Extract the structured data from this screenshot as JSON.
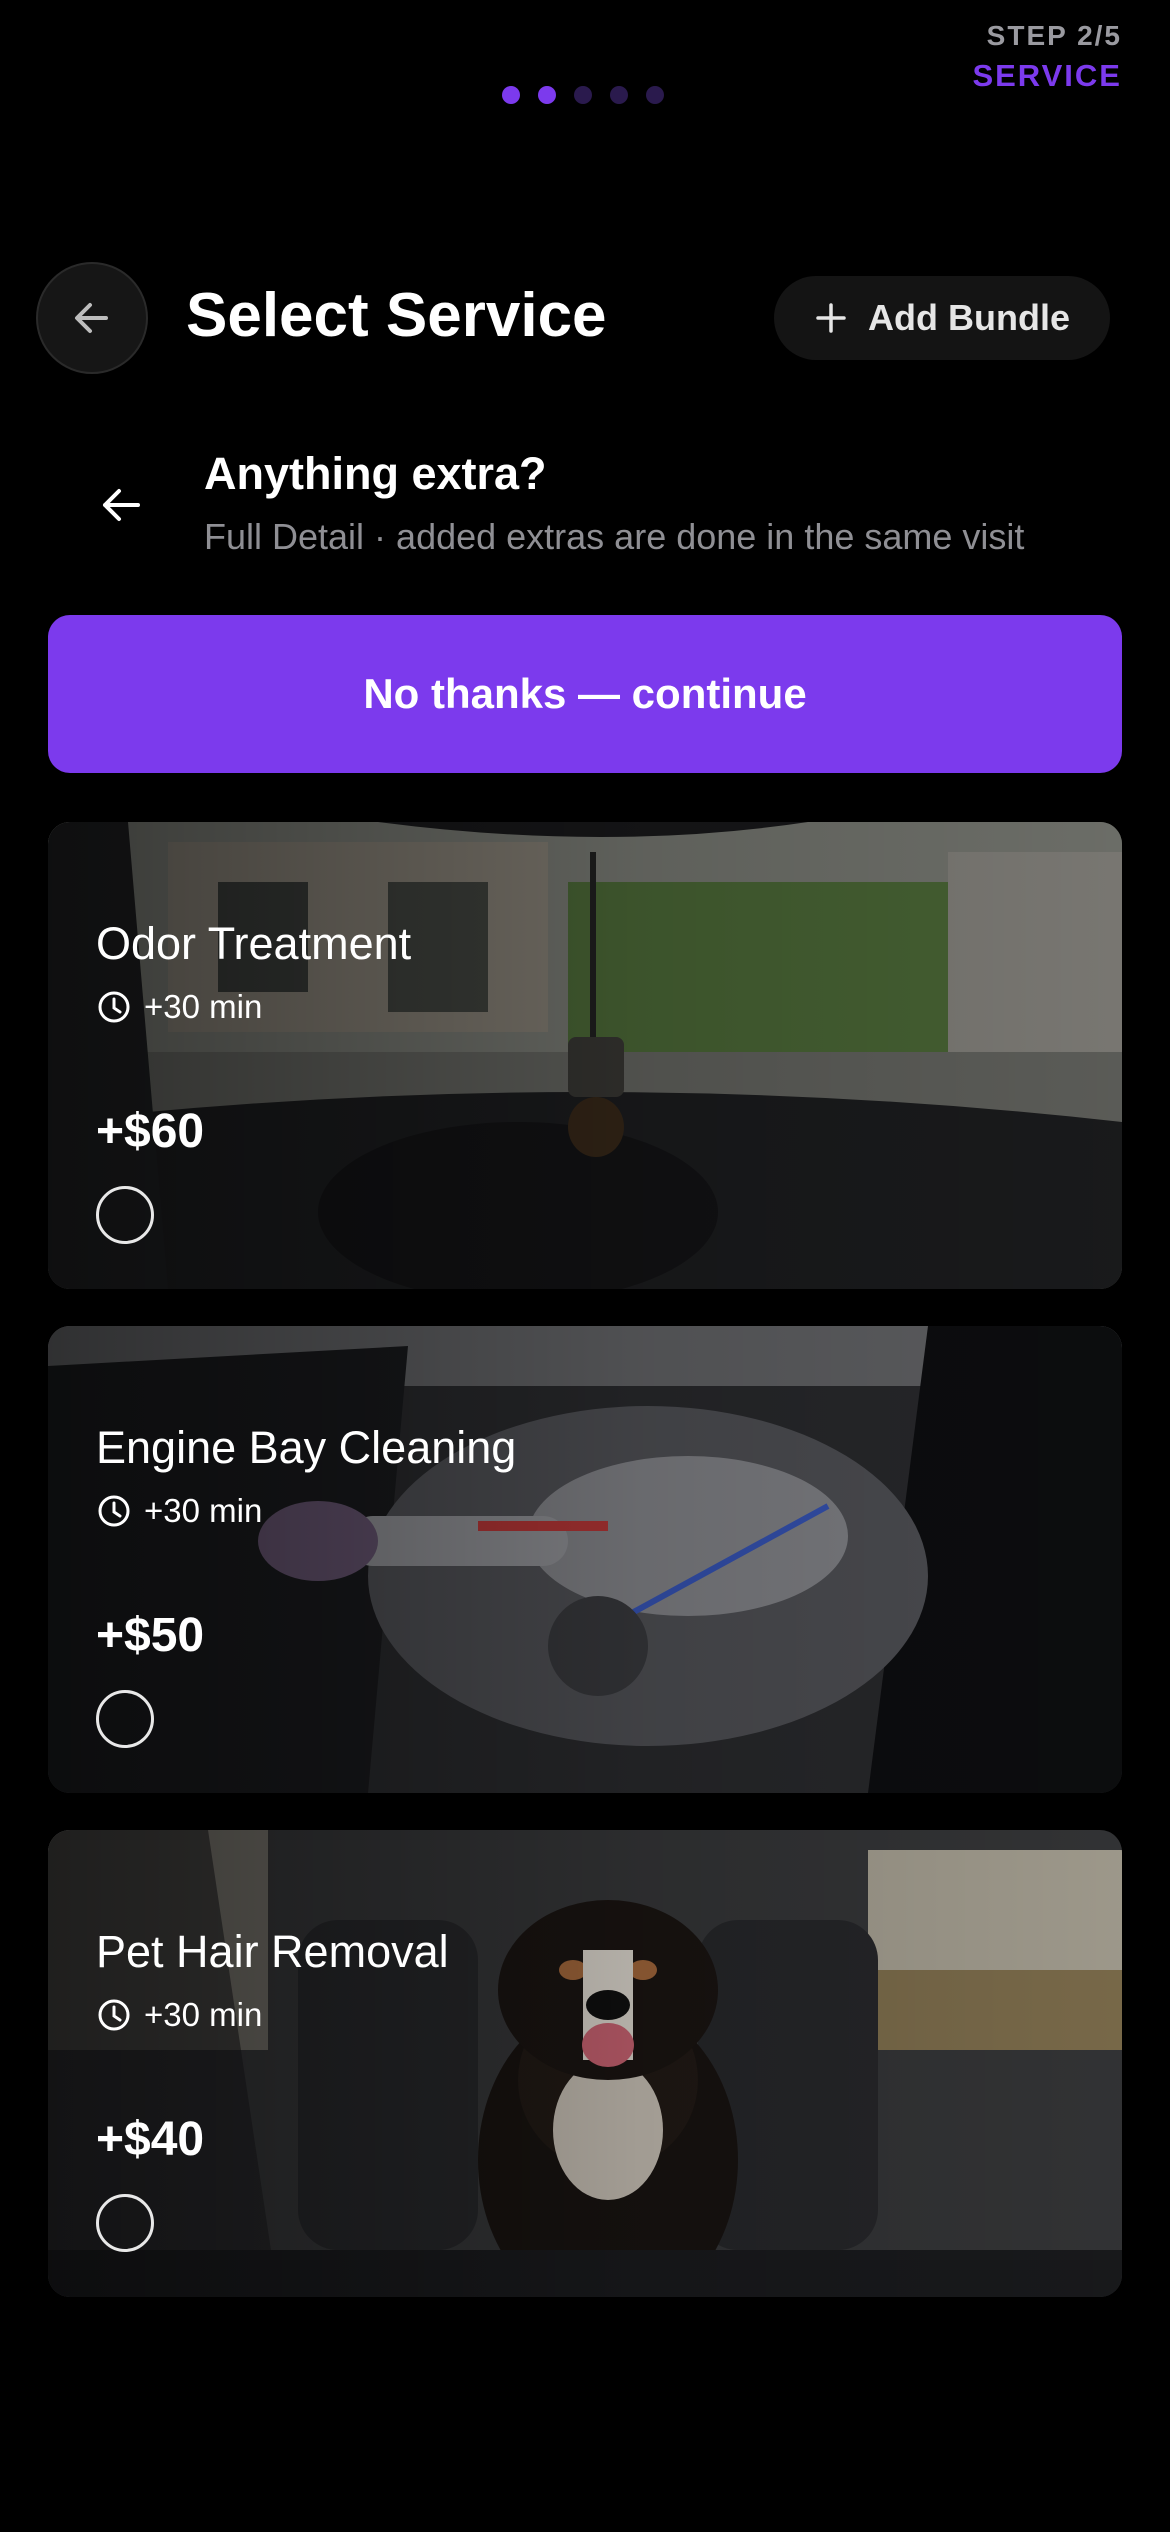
{
  "progress": {
    "total_steps": 5,
    "current_step": 2,
    "step_label": "STEP 2/5",
    "step_name": "SERVICE"
  },
  "header": {
    "title": "Select Service",
    "bundle_label": "Add Bundle"
  },
  "extras": {
    "title": "Anything extra?",
    "subtitle": "Full Detail · added extras are done in the same visit",
    "continue_label": "No thanks — continue"
  },
  "addons": [
    {
      "name": "Odor Treatment",
      "duration": "+30 min",
      "price": "+$60",
      "selected": false
    },
    {
      "name": "Engine Bay Cleaning",
      "duration": "+30 min",
      "price": "+$50",
      "selected": false
    },
    {
      "name": "Pet Hair Removal",
      "duration": "+30 min",
      "price": "+$40",
      "selected": false
    }
  ],
  "colors": {
    "accent": "#7c3aed",
    "background": "#000000",
    "muted": "#8f8f94"
  }
}
